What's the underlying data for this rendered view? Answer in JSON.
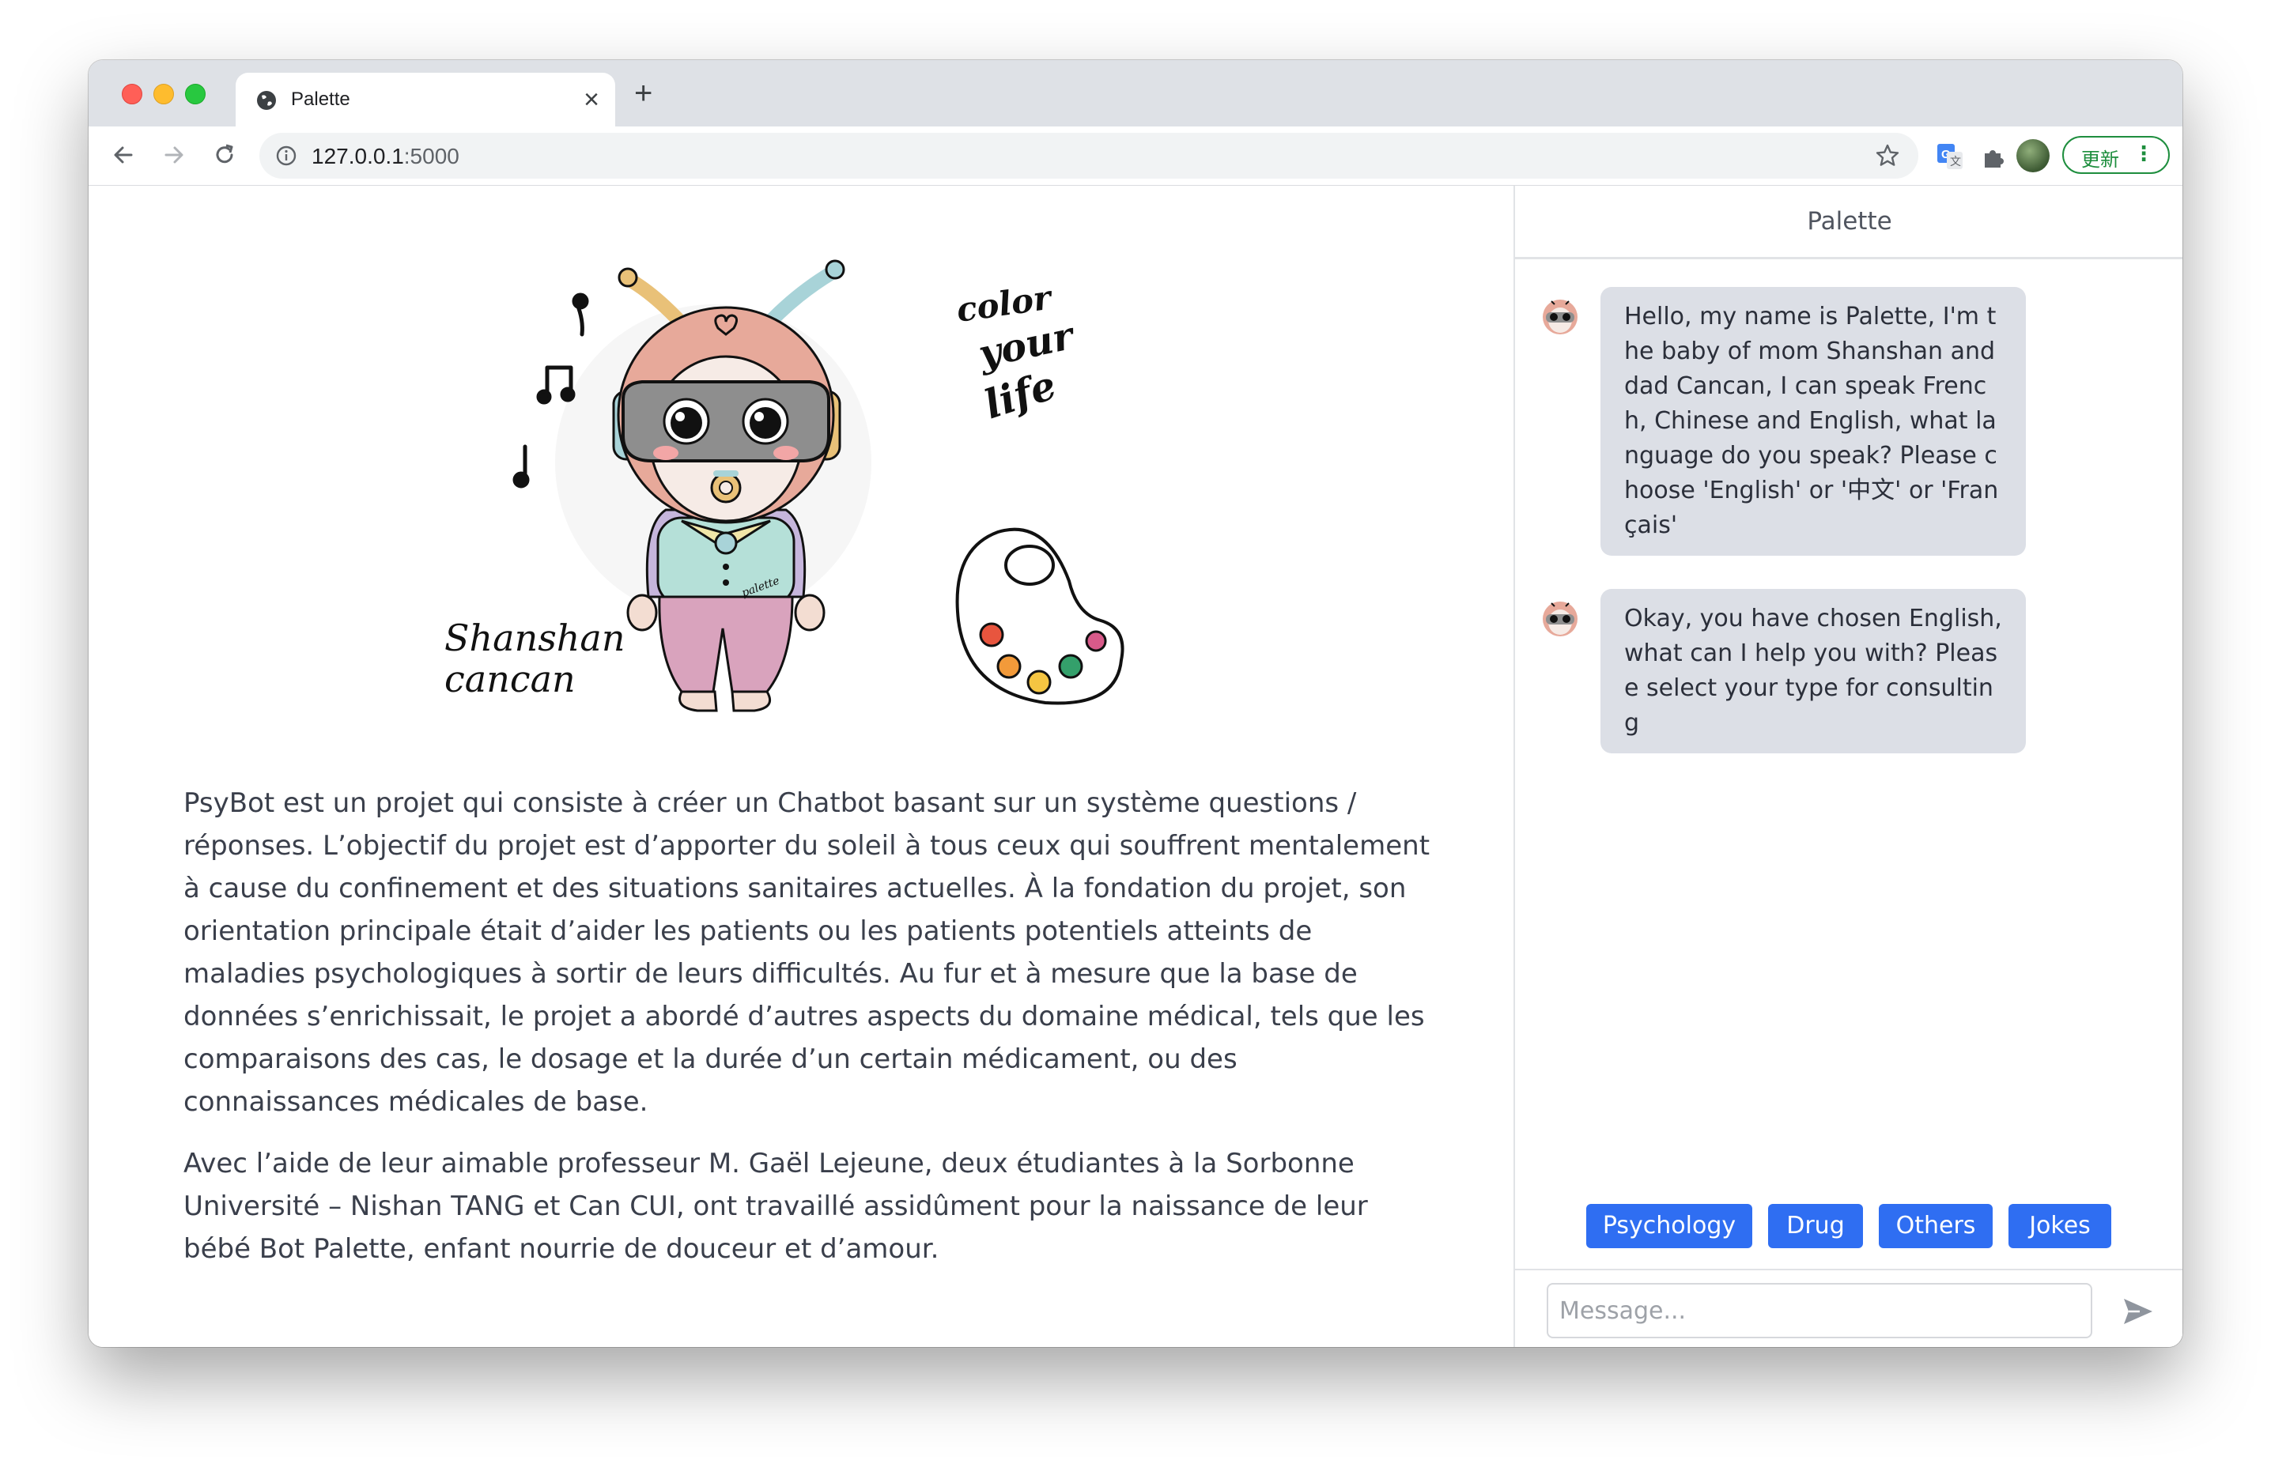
{
  "browser": {
    "tab_title": "Palette",
    "url_host": "127.0.0.1",
    "url_port": ":5000",
    "update_label": "更新"
  },
  "illustration": {
    "color_text": [
      "color",
      "your",
      "life"
    ],
    "names": [
      "Shanshan",
      "cancan"
    ],
    "shirt_text": "palette"
  },
  "intro": {
    "paragraph1": "PsyBot est un projet qui consiste à créer un Chatbot basant sur un système questions / réponses. L’objectif du projet est d’apporter du soleil à tous ceux qui souffrent mentalement à cause du confinement et des situations sanitaires actuelles. À la fondation du projet, son orientation principale était d’aider les patients ou les patients potentiels atteints de maladies psychologiques à sortir de leurs difficultés. Au fur et à mesure que la base de données s’enrichissait, le projet a abordé d’autres aspects du domaine médical, tels que les comparaisons des cas, le dosage et la durée d’un certain médicament, ou des connaissances médicales de base.",
    "paragraph2": "Avec l’aide de leur aimable professeur M. Gaël Lejeune, deux étudiantes à la Sorbonne Université – Nishan TANG et Can CUI, ont travaillé assidûment pour la naissance de leur bébé Bot Palette, enfant nourrie de douceur et d’amour."
  },
  "chat": {
    "header": "Palette",
    "messages": [
      {
        "text": "Hello, my name is Palette, I'm the baby of mom Shanshan and dad Cancan, I can speak French, Chinese and English, what language do you speak? Please choose 'English' or '中文' or 'Français'"
      },
      {
        "text": "Okay, you have chosen English, what can I help you with? Please select your type for consulting"
      }
    ],
    "quick_replies": [
      "Psychology",
      "Drug",
      "Others",
      "Jokes"
    ],
    "input_placeholder": "Message..."
  },
  "colors": {
    "accent": "#2f6ef2",
    "bubble": "#dcdfe6",
    "update_green": "#1e8e3e"
  }
}
